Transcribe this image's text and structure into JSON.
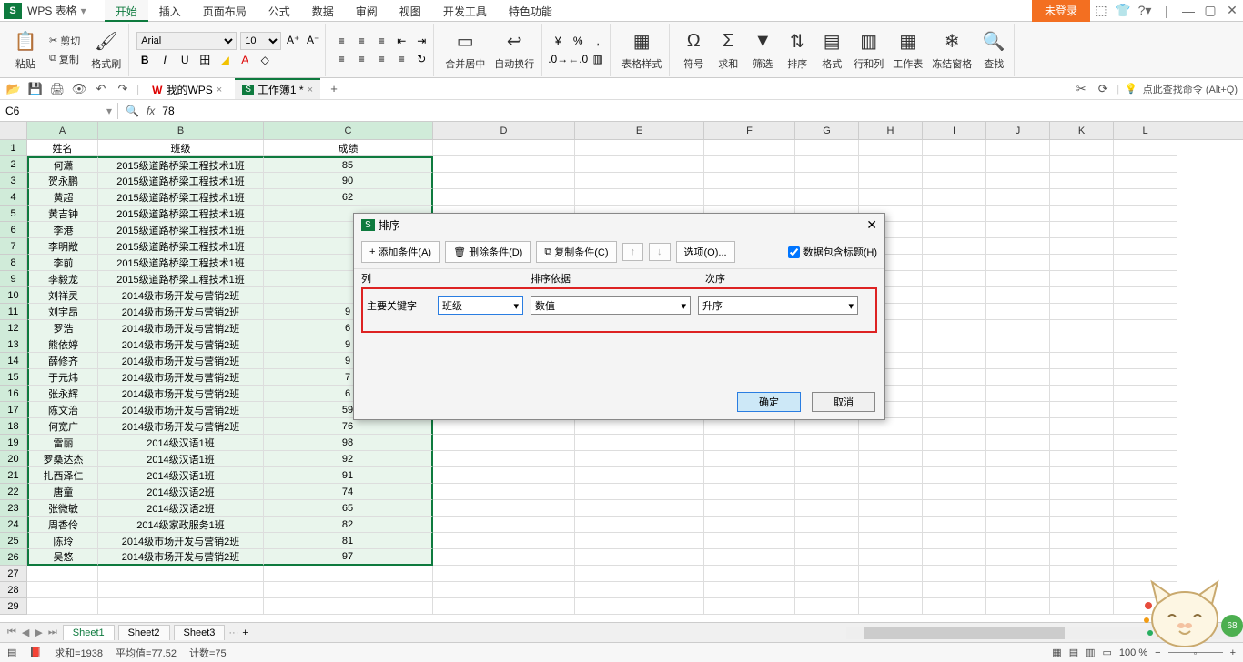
{
  "app": {
    "name": "WPS 表格",
    "logo": "S"
  },
  "menu_tabs": [
    "开始",
    "插入",
    "页面布局",
    "公式",
    "数据",
    "审阅",
    "视图",
    "开发工具",
    "特色功能"
  ],
  "active_menu_tab": 0,
  "login_button": "未登录",
  "ribbon": {
    "paste": "粘贴",
    "cut": "剪切",
    "copy": "复制",
    "format_painter": "格式刷",
    "font_name": "Arial",
    "font_size": "10",
    "merge_center": "合并居中",
    "auto_wrap": "自动换行",
    "table_style": "表格样式",
    "symbol": "符号",
    "sum": "求和",
    "filter": "筛选",
    "sort": "排序",
    "format": "格式",
    "row_col": "行和列",
    "worksheet": "工作表",
    "freeze": "冻结窗格",
    "find": "查找"
  },
  "doc_tabs": [
    {
      "label": "我的WPS",
      "icon": "W"
    },
    {
      "label": "工作簿1 *",
      "icon": "S"
    }
  ],
  "active_doc_tab": 1,
  "search_hint": "点此查找命令 (Alt+Q)",
  "name_box": "C6",
  "formula_value": "78",
  "columns": [
    "A",
    "B",
    "C",
    "D",
    "E",
    "F",
    "G",
    "H",
    "I",
    "J",
    "K",
    "L"
  ],
  "header_row": {
    "A": "姓名",
    "B": "班级",
    "C": "成绩"
  },
  "rows": [
    {
      "r": 2,
      "A": "何潇",
      "B": "2015级道路桥梁工程技术1班",
      "C": "85"
    },
    {
      "r": 3,
      "A": "贺永鹏",
      "B": "2015级道路桥梁工程技术1班",
      "C": "90"
    },
    {
      "r": 4,
      "A": "黄超",
      "B": "2015级道路桥梁工程技术1班",
      "C": "62"
    },
    {
      "r": 5,
      "A": "黄吉钟",
      "B": "2015级道路桥梁工程技术1班",
      "C": ""
    },
    {
      "r": 6,
      "A": "李港",
      "B": "2015级道路桥梁工程技术1班",
      "C": ""
    },
    {
      "r": 7,
      "A": "李明敞",
      "B": "2015级道路桥梁工程技术1班",
      "C": ""
    },
    {
      "r": 8,
      "A": "李前",
      "B": "2015级道路桥梁工程技术1班",
      "C": ""
    },
    {
      "r": 9,
      "A": "李毅龙",
      "B": "2015级道路桥梁工程技术1班",
      "C": ""
    },
    {
      "r": 10,
      "A": "刘祥灵",
      "B": "2014级市场开发与营销2班",
      "C": ""
    },
    {
      "r": 11,
      "A": "刘宇昂",
      "B": "2014级市场开发与营销2班",
      "C": "9"
    },
    {
      "r": 12,
      "A": "罗浩",
      "B": "2014级市场开发与营销2班",
      "C": "6"
    },
    {
      "r": 13,
      "A": "熊依婷",
      "B": "2014级市场开发与营销2班",
      "C": "9"
    },
    {
      "r": 14,
      "A": "薛修齐",
      "B": "2014级市场开发与营销2班",
      "C": "9"
    },
    {
      "r": 15,
      "A": "于元炜",
      "B": "2014级市场开发与营销2班",
      "C": "7"
    },
    {
      "r": 16,
      "A": "张永辉",
      "B": "2014级市场开发与营销2班",
      "C": "6"
    },
    {
      "r": 17,
      "A": "陈文治",
      "B": "2014级市场开发与营销2班",
      "C": "59"
    },
    {
      "r": 18,
      "A": "何宽广",
      "B": "2014级市场开发与营销2班",
      "C": "76"
    },
    {
      "r": 19,
      "A": "雷丽",
      "B": "2014级汉语1班",
      "C": "98"
    },
    {
      "r": 20,
      "A": "罗桑达杰",
      "B": "2014级汉语1班",
      "C": "92"
    },
    {
      "r": 21,
      "A": "扎西泽仁",
      "B": "2014级汉语1班",
      "C": "91"
    },
    {
      "r": 22,
      "A": "唐童",
      "B": "2014级汉语2班",
      "C": "74"
    },
    {
      "r": 23,
      "A": "张微敏",
      "B": "2014级汉语2班",
      "C": "65"
    },
    {
      "r": 24,
      "A": "周香伶",
      "B": "2014级家政服务1班",
      "C": "82"
    },
    {
      "r": 25,
      "A": "陈玲",
      "B": "2014级市场开发与营销2班",
      "C": "81"
    },
    {
      "r": 26,
      "A": "吴悠",
      "B": "2014级市场开发与营销2班",
      "C": "97"
    }
  ],
  "empty_rows": [
    27,
    28,
    29
  ],
  "sheet_tabs": [
    "Sheet1",
    "Sheet2",
    "Sheet3"
  ],
  "active_sheet": 0,
  "status": {
    "sum_label": "求和=1938",
    "avg_label": "平均值=77.52",
    "count_label": "计数=75",
    "zoom": "100 %"
  },
  "dialog": {
    "title": "排序",
    "add_cond": "添加条件(A)",
    "del_cond": "删除条件(D)",
    "copy_cond": "复制条件(C)",
    "options": "选项(O)...",
    "has_header_label": "数据包含标题(H)",
    "col_hdr_1": "列",
    "col_hdr_2": "排序依据",
    "col_hdr_3": "次序",
    "primary_label": "主要关键字",
    "sel_col": "班级",
    "sel_basis": "数值",
    "sel_order": "升序",
    "ok": "确定",
    "cancel": "取消"
  },
  "badge": "68"
}
